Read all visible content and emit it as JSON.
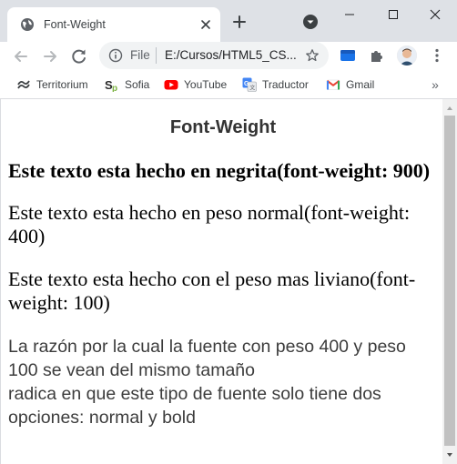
{
  "tab": {
    "title": "Font-Weight"
  },
  "omnibox": {
    "scheme": "File",
    "url": "E:/Cursos/HTML5_CS..."
  },
  "bookmarks": [
    {
      "label": "Territorium",
      "icon": "territorium-icon"
    },
    {
      "label": "Sofia",
      "icon": "sofia-icon"
    },
    {
      "label": "YouTube",
      "icon": "youtube-icon"
    },
    {
      "label": "Traductor",
      "icon": "translate-icon"
    },
    {
      "label": "Gmail",
      "icon": "gmail-icon"
    }
  ],
  "bookmarks_more": "»",
  "page": {
    "title": "Font-Weight",
    "bold_text": "Este texto esta hecho en negrita(font-weight: 900)",
    "normal_text": "Este texto esta hecho en peso normal(font-weight: 400)",
    "light_text": "Este texto esta hecho con el peso mas liviano(font-weight: 100)",
    "note_line1": "La razón por la cual la fuente con peso 400 y peso 100 se vean del mismo tamaño",
    "note_line2": "radica en que este tipo de fuente solo tiene dos opciones: normal y bold"
  },
  "colors": {
    "tabstrip": "#dee1e6",
    "youtube": "#ff0000",
    "gmail_red": "#ea4335",
    "ext_blue": "#1a73e8"
  }
}
